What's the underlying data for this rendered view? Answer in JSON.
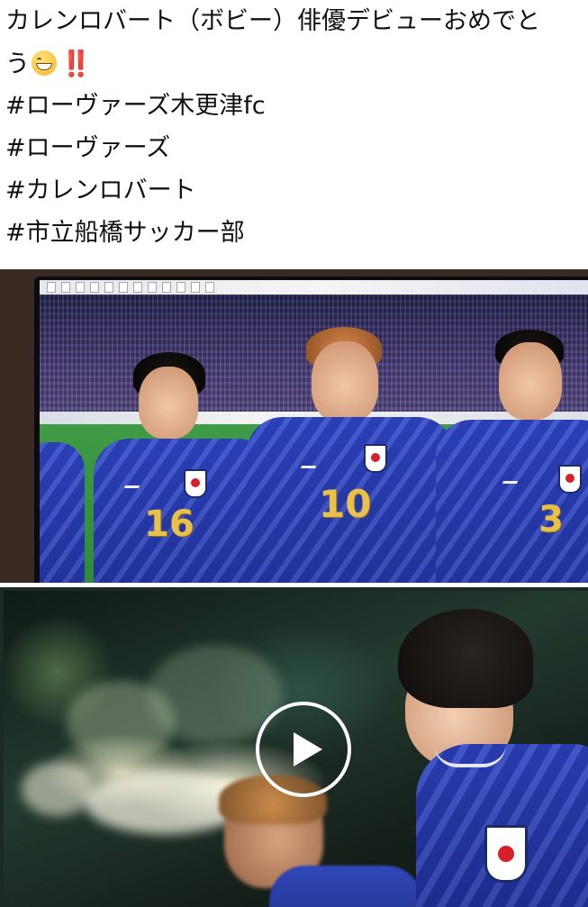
{
  "post": {
    "line1": "カレンロバート（ボビー）俳優デビューおめでと",
    "line2_prefix": "う",
    "line2_emoji": "grinning-face-with-smiling-eyes",
    "line2_exclaim": "‼️",
    "hashtags": [
      "#ローヴァーズ木更津fc",
      "#ローヴァーズ",
      "#カレンロバート",
      "#市立船橋サッカー部"
    ]
  },
  "media1": {
    "jersey_numbers": [
      "16",
      "10",
      "3"
    ]
  },
  "media2": {
    "play_icon": "play-icon"
  },
  "colors": {
    "text": "#111111",
    "jersey_blue": "#2437a8",
    "jersey_number": "#e8c04a",
    "exclaim_red": "#e0182d"
  }
}
